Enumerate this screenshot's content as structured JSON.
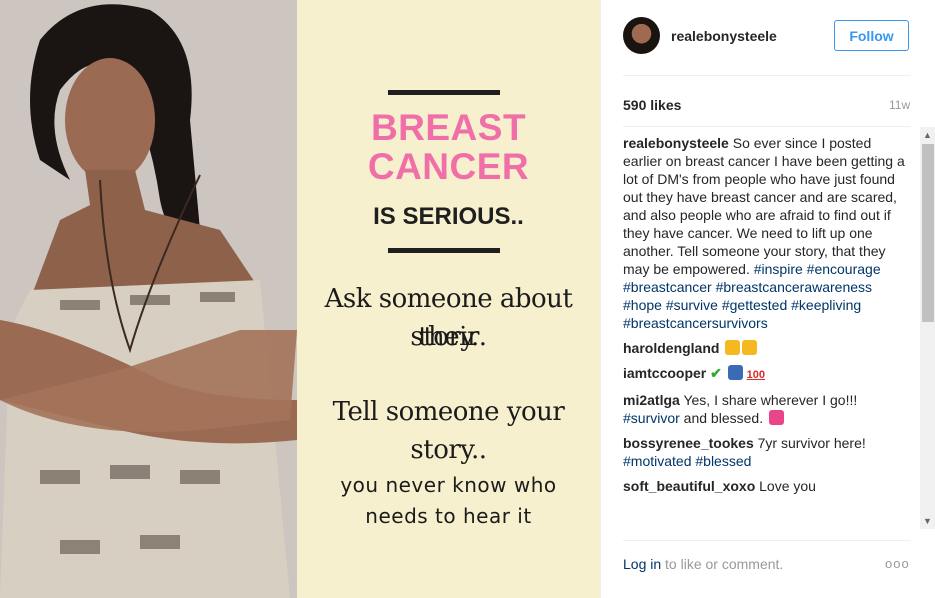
{
  "post_image": {
    "line1": "BREAST",
    "line2": "CANCER",
    "line3": "IS SERIOUS..",
    "line4": "Ask someone about their",
    "line5": "story..",
    "line6": "Tell someone your story..",
    "line7": "you never know who",
    "line8": "needs to hear it"
  },
  "header": {
    "username": "realebonysteele",
    "follow_label": "Follow"
  },
  "stats": {
    "likes": "590 likes",
    "age": "11w"
  },
  "caption": {
    "username": "realebonysteele",
    "text": "So ever since I posted earlier on breast cancer I have been getting a lot of DM's from people who have just found out they have breast cancer and are scared, and also people who are afraid to find out if they have cancer. We need to lift up one another. Tell someone your story, that they may be empowered.",
    "hashtags": "#inspire #encourage #breastcancer #breastcancerawareness #hope #survive #gettested #keepliving #breastcancersurvivors"
  },
  "comments": [
    {
      "user": "haroldengland",
      "text": ""
    },
    {
      "user": "iamtccooper",
      "text": ""
    },
    {
      "user": "mi2atlga",
      "text": "Yes, I share wherever I go!!!",
      "tag": "#survivor",
      "tail": " and blessed."
    },
    {
      "user": "bossyrenee_tookes",
      "text": "7yr survivor here!",
      "tag": "#motivated #blessed"
    },
    {
      "user": "soft_beautiful_xoxo",
      "text": "Love you"
    }
  ],
  "footer": {
    "login_link": "Log in",
    "login_rest": " to like or comment.",
    "more": "ooo"
  },
  "colors": {
    "accent": "#3897f0",
    "pink": "#f06fa8",
    "cream": "#f6f0cf",
    "hashtag": "#003569"
  }
}
